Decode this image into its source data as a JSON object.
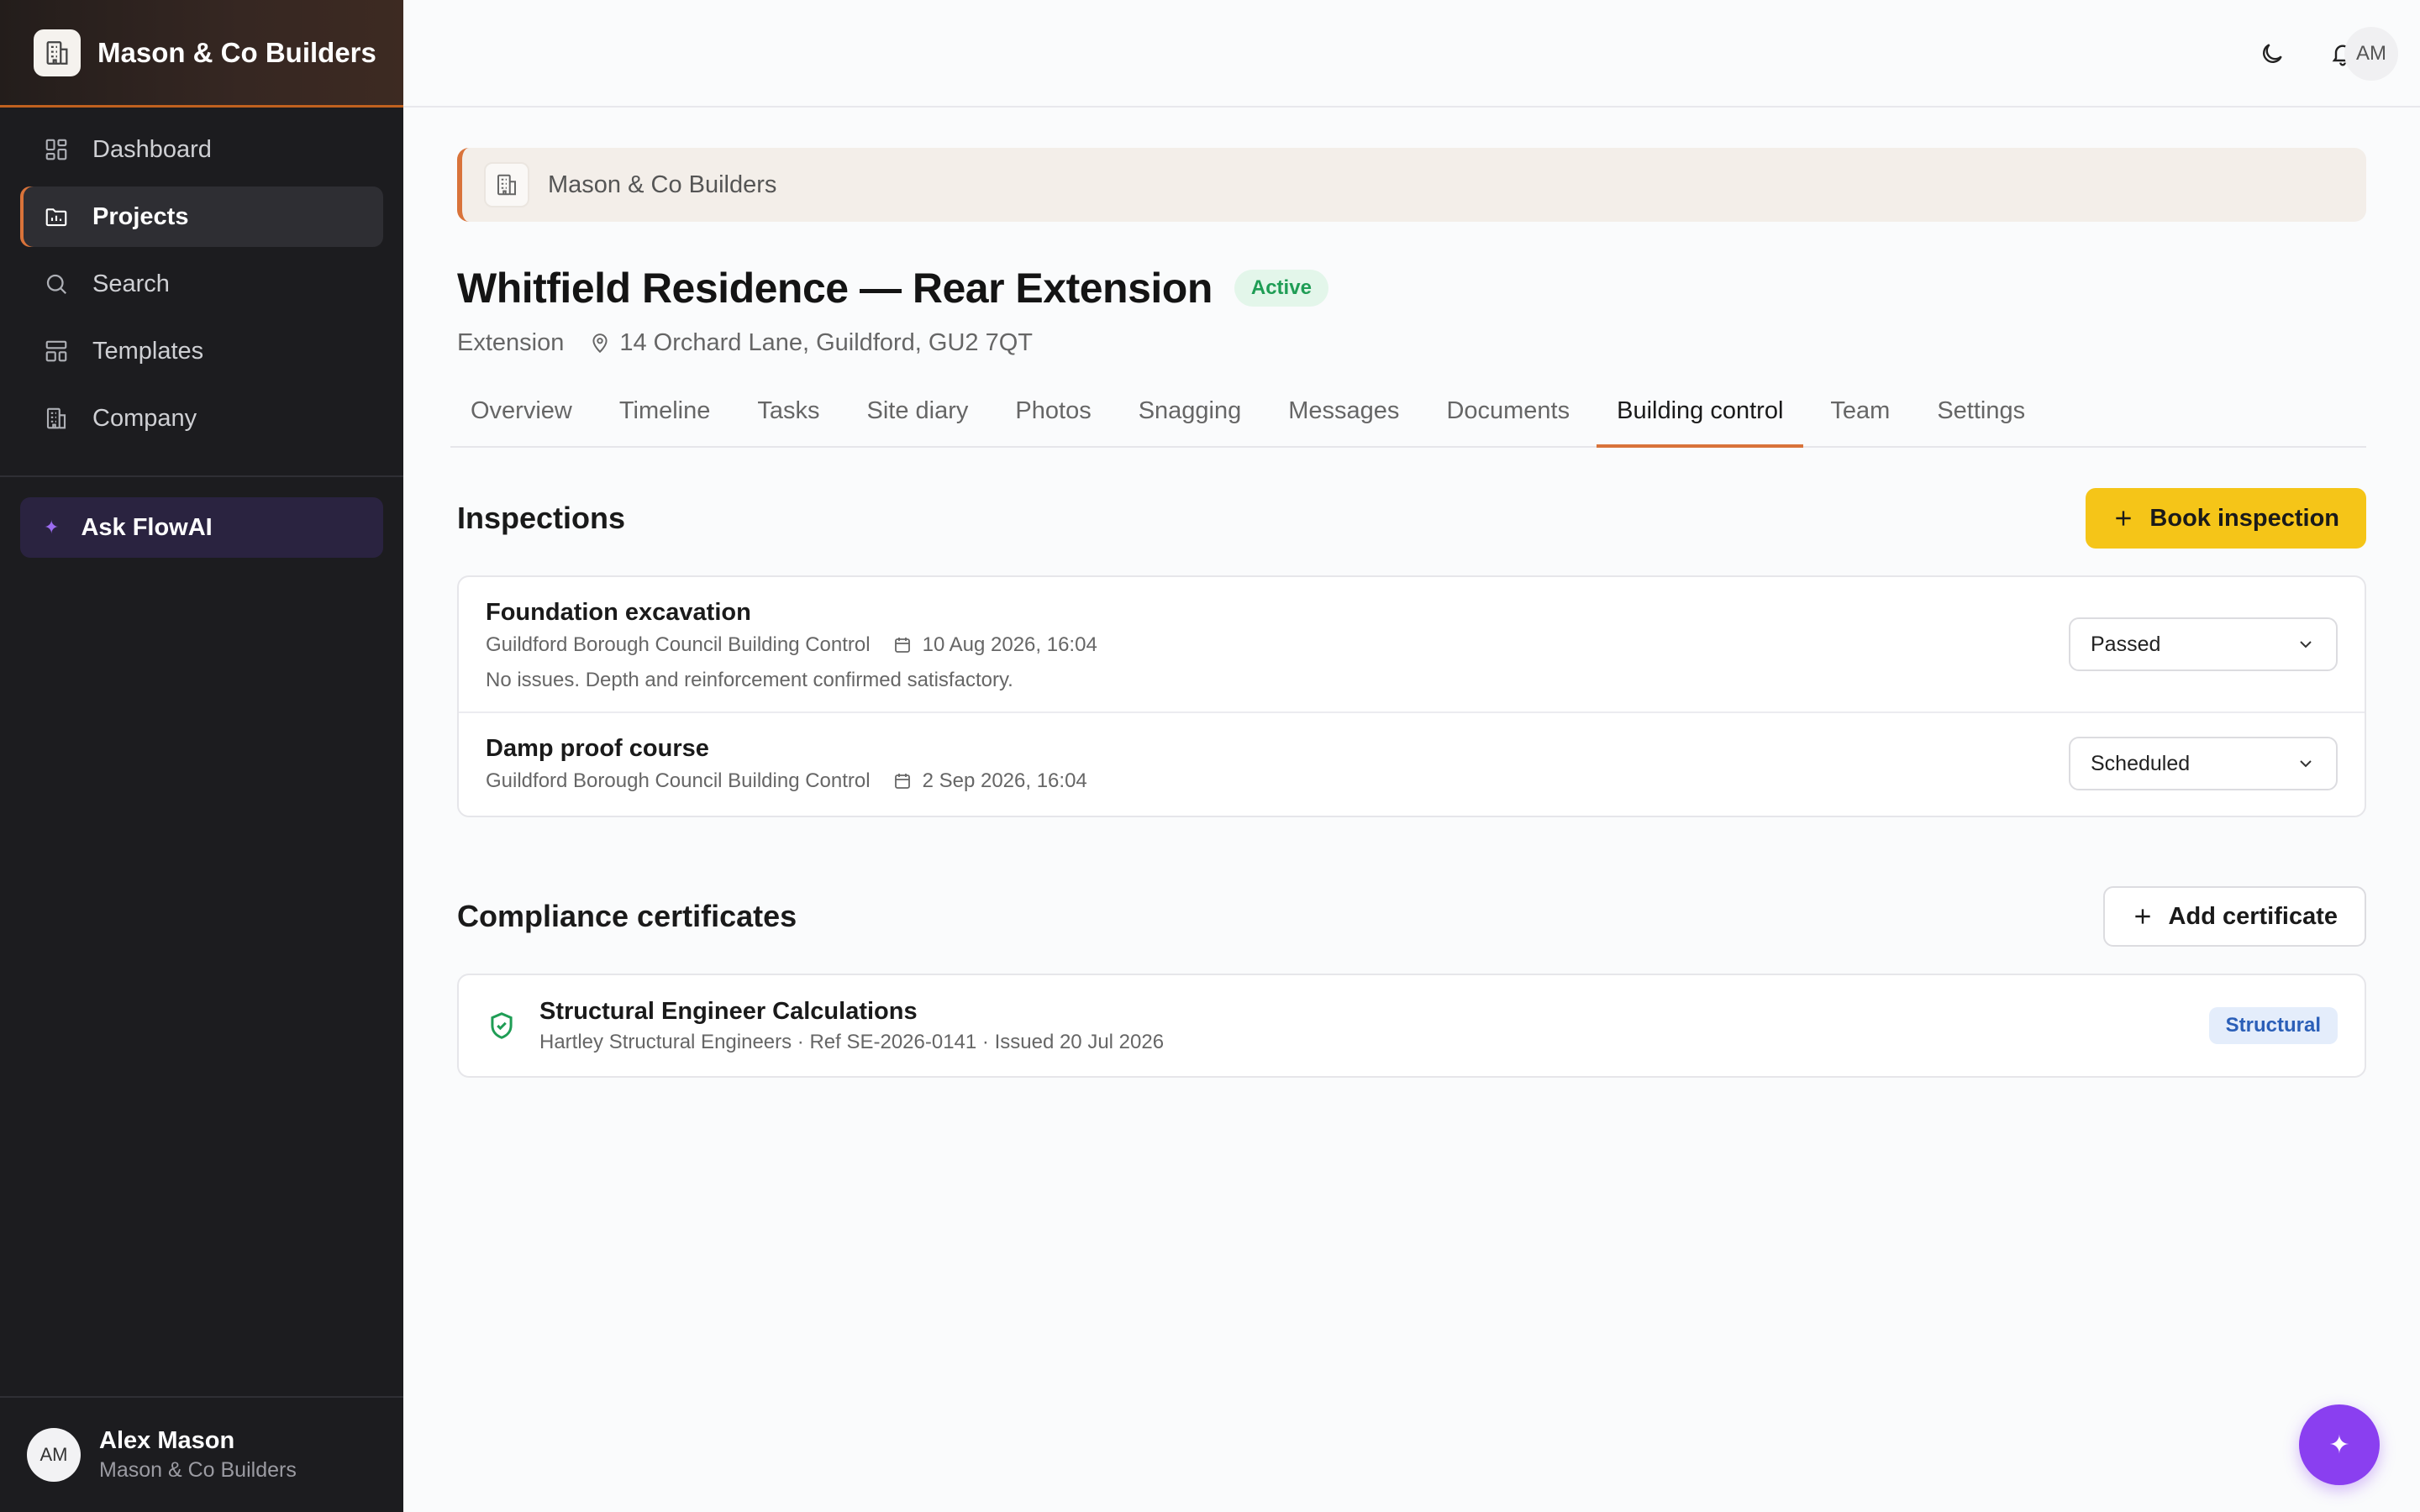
{
  "app": {
    "brand_name": "Mason & Co Builders",
    "colors": {
      "accent": "#d9733a",
      "primary_button": "#f5c518",
      "ai_purple": "#8a3ff0",
      "success": "#1f9d55"
    }
  },
  "sidebar": {
    "items": [
      {
        "label": "Dashboard",
        "icon": "dashboard-icon"
      },
      {
        "label": "Projects",
        "icon": "projects-icon",
        "active": true
      },
      {
        "label": "Search",
        "icon": "search-icon"
      },
      {
        "label": "Templates",
        "icon": "templates-icon"
      },
      {
        "label": "Company",
        "icon": "company-icon"
      }
    ],
    "ask_label": "Ask FlowAI",
    "user": {
      "initials": "AM",
      "name": "Alex Mason",
      "org": "Mason & Co Builders"
    }
  },
  "topbar": {
    "avatar_initials": "AM",
    "icons": [
      "moon-icon",
      "bell-icon"
    ]
  },
  "project": {
    "company_banner": "Mason & Co Builders",
    "title": "Whitfield Residence — Rear Extension",
    "status": "Active",
    "type": "Extension",
    "address": "14 Orchard Lane, Guildford, GU2 7QT"
  },
  "tabs": [
    "Overview",
    "Timeline",
    "Tasks",
    "Site diary",
    "Photos",
    "Snagging",
    "Messages",
    "Documents",
    "Building control",
    "Team",
    "Settings"
  ],
  "active_tab": "Building control",
  "inspections": {
    "heading": "Inspections",
    "button_label": "Book inspection",
    "items": [
      {
        "title": "Foundation excavation",
        "authority": "Guildford Borough Council Building Control",
        "date": "10 Aug 2026, 16:04",
        "note": "No issues. Depth and reinforcement confirmed satisfactory.",
        "status": "Passed"
      },
      {
        "title": "Damp proof course",
        "authority": "Guildford Borough Council Building Control",
        "date": "2 Sep 2026, 16:04",
        "status": "Scheduled"
      }
    ]
  },
  "certificates": {
    "heading": "Compliance certificates",
    "button_label": "Add certificate",
    "items": [
      {
        "title": "Structural Engineer Calculations",
        "meta": "Hartley Structural Engineers · Ref SE-2026-0141 · Issued 20 Jul 2026",
        "tag": "Structural"
      }
    ]
  }
}
